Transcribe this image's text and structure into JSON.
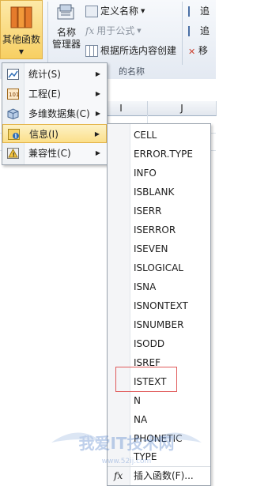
{
  "ribbon": {
    "more_functions_label": "其他函数",
    "name_manager_line1": "名称",
    "name_manager_line2": "管理器",
    "define_name": "定义名称",
    "use_in_formula": "用于公式",
    "create_from_selection": "根据所选内容创建",
    "defined_names_group": "的名称",
    "right_top": "追",
    "right_mid": "追",
    "right_bot": "移"
  },
  "sheet": {
    "col_i": "I",
    "col_j": "J"
  },
  "menu": {
    "items": [
      {
        "label": "统计(S)",
        "icon": "statistics-icon"
      },
      {
        "label": "工程(E)",
        "icon": "engineering-icon"
      },
      {
        "label": "多维数据集(C)",
        "icon": "cube-icon"
      },
      {
        "label": "信息(I)",
        "icon": "info-icon"
      },
      {
        "label": "兼容性(C)",
        "icon": "compatibility-icon"
      }
    ]
  },
  "submenu": {
    "functions": [
      "CELL",
      "ERROR.TYPE",
      "INFO",
      "ISBLANK",
      "ISERR",
      "ISERROR",
      "ISEVEN",
      "ISLOGICAL",
      "ISNA",
      "ISNONTEXT",
      "ISNUMBER",
      "ISODD",
      "ISREF",
      "ISTEXT",
      "N",
      "NA",
      "PHONETIC",
      "TYPE"
    ],
    "highlighted": "ISTEXT",
    "insert_function": "插入函数(F)..."
  },
  "watermark": {
    "text": "我爱IT技术网",
    "url": "www.52ij.com"
  }
}
